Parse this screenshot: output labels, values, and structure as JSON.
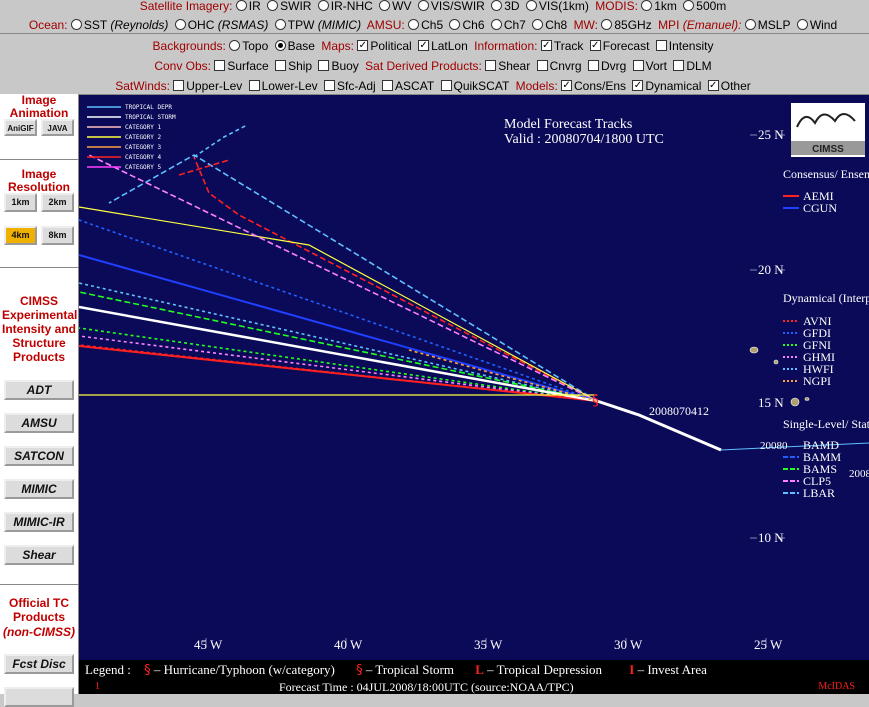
{
  "toolbar": {
    "row1": {
      "label": "Satellite Imagery:",
      "options": [
        "IR",
        "SWIR",
        "IR-NHC",
        "WV",
        "VIS/SWIR",
        "3D",
        "VIS(1km)"
      ],
      "modis_label": "MODIS:",
      "modis_options": [
        "1km",
        "500m"
      ]
    },
    "row2": {
      "ocean_label": "Ocean:",
      "ocean_options": [
        "SST",
        "OHC",
        "TPW"
      ],
      "ocean_sources": [
        "(Reynolds)",
        "(RSMAS)",
        "(MIMIC)"
      ],
      "amsu_label": "AMSU:",
      "amsu_options": [
        "Ch5",
        "Ch6",
        "Ch7",
        "Ch8"
      ],
      "mw_label": "MW:",
      "mw_options": [
        "85GHz"
      ],
      "mpi_label": "MPI",
      "mpi_source": "(Emanuel):",
      "mpi_options": [
        "MSLP",
        "Wind"
      ]
    },
    "row3": {
      "backgrounds_label": "Backgrounds:",
      "backgrounds": [
        "Topo",
        "Base"
      ],
      "maps_label": "Maps:",
      "maps": [
        "Political",
        "LatLon"
      ],
      "info_label": "Information:",
      "info": [
        "Track",
        "Forecast",
        "Intensity"
      ]
    },
    "row4": {
      "convobs_label": "Conv Obs:",
      "convobs": [
        "Surface",
        "Ship",
        "Buoy"
      ],
      "satderived_label": "Sat Derived Products:",
      "satderived": [
        "Shear",
        "Cnvrg",
        "Dvrg",
        "Vort",
        "DLM"
      ]
    },
    "row5": {
      "satwinds_label": "SatWinds:",
      "satwinds": [
        "Upper-Lev",
        "Lower-Lev",
        "Sfc-Adj",
        "ASCAT",
        "QuikSCAT"
      ],
      "models_label": "Models:",
      "models": [
        "Cons/Ens",
        "Dynamical",
        "Other"
      ]
    }
  },
  "sidebar": {
    "animation_heading": "Image Animation",
    "animation_buttons": [
      "AniGIF",
      "JAVA"
    ],
    "resolution_heading": "Image Resolution",
    "resolution_buttons": [
      "1km",
      "2km",
      "4km",
      "8km"
    ],
    "cimss_heading": "CIMSS Experimental Intensity and Structure Products",
    "products": [
      "ADT",
      "AMSU",
      "SATCON",
      "MIMIC",
      "MIMIC-IR",
      "Shear"
    ],
    "official_heading": "Official TC Products",
    "official_sub": "(non-CIMSS)",
    "official_buttons": [
      "Fcst Disc"
    ]
  },
  "map": {
    "title_line1": "Model Forecast Tracks",
    "title_line2": "Valid : 20080704/1800 UTC",
    "lat_labels": [
      "25 N",
      "20 N",
      "15 N",
      "10 N"
    ],
    "lon_labels": [
      "45 W",
      "40 W",
      "35 W",
      "30 W",
      "25 W"
    ],
    "storm_label": "2008070412",
    "track_label": "20080",
    "track_label2": "2008",
    "track_label3": "BAMD",
    "category_legend": [
      "TROPICAL DEPR",
      "TROPICAL STORM",
      "CATEGORY 1",
      "CATEGORY 2",
      "CATEGORY 3",
      "CATEGORY 4",
      "CATEGORY 5"
    ],
    "category_colors": [
      "#60c0ff",
      "#ffffff",
      "#ffc0c0",
      "#ffff40",
      "#ffa040",
      "#ff2020",
      "#ff40ff"
    ],
    "logo_text": "CIMSS",
    "groups": [
      {
        "heading": "Consensus/ Ensemble",
        "models": [
          {
            "name": "AEMI",
            "color": "#ff2020",
            "dash": "solid"
          },
          {
            "name": "CGUN",
            "color": "#2040ff",
            "dash": "solid"
          }
        ]
      },
      {
        "heading": "Dynamical (Interpolated)",
        "models": [
          {
            "name": "AVNI",
            "color": "#ff2020",
            "dash": "dot"
          },
          {
            "name": "GFDI",
            "color": "#2060ff",
            "dash": "dot"
          },
          {
            "name": "GFNI",
            "color": "#20ff20",
            "dash": "dot"
          },
          {
            "name": "GHMI",
            "color": "#ff80ff",
            "dash": "dot"
          },
          {
            "name": "HWFI",
            "color": "#60c0ff",
            "dash": "dot"
          },
          {
            "name": "NGPI",
            "color": "#ffa040",
            "dash": "dot"
          }
        ]
      },
      {
        "heading": "Single-Level/ Statistical",
        "models": [
          {
            "name": "BAMM",
            "color": "#2060ff",
            "dash": "dash"
          },
          {
            "name": "BAMS",
            "color": "#20ff20",
            "dash": "dash"
          },
          {
            "name": "CLP5",
            "color": "#ff80ff",
            "dash": "dash"
          },
          {
            "name": "LBAR",
            "color": "#60c0ff",
            "dash": "dash"
          }
        ]
      }
    ]
  },
  "legend": {
    "label": "Legend :",
    "items": [
      "– Hurricane/Typhoon (w/category)",
      "– Tropical Storm",
      "– Tropical Depression",
      "– Invest Area"
    ],
    "symbols": [
      "L",
      "I"
    ]
  },
  "footer": {
    "text": "Forecast Time : 04JUL2008/18:00UTC (source:NOAA/TPC)",
    "left": "1",
    "right": "McIDAS"
  }
}
